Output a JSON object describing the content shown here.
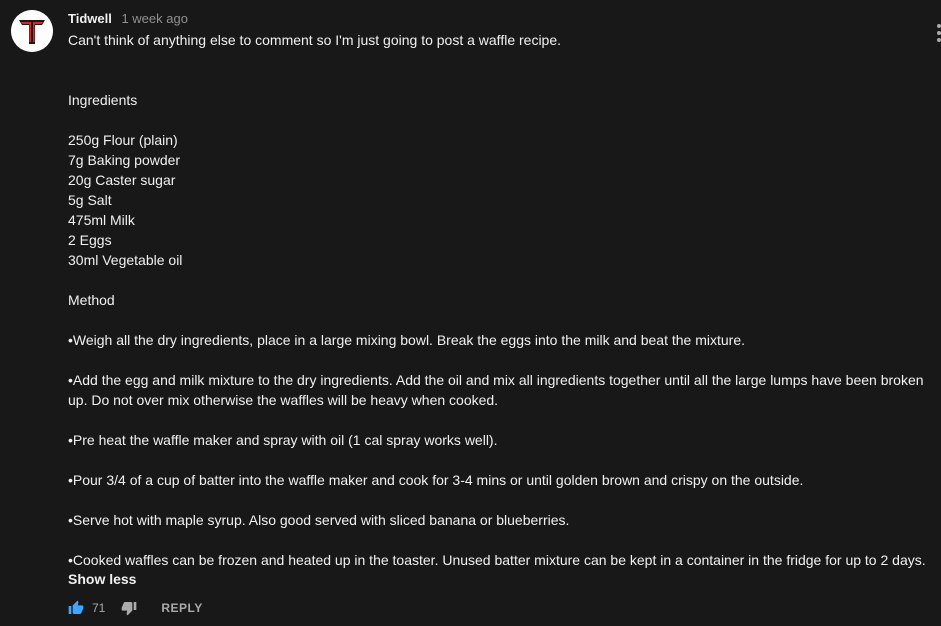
{
  "comment": {
    "author": "Tidwell",
    "timestamp": "1 week ago",
    "lines": [
      "Can't think of anything else to comment so I'm just going to post a waffle recipe.",
      "",
      "",
      "Ingredients",
      "",
      "250g Flour (plain)",
      "7g Baking powder",
      "20g Caster sugar",
      "5g Salt",
      "475ml Milk",
      "2 Eggs",
      "30ml Vegetable oil",
      "",
      "Method",
      "",
      "•Weigh all the dry ingredients, place in a large mixing bowl. Break the eggs into the milk and beat the mixture.",
      "",
      "•Add the egg and milk mixture to the dry ingredients. Add the oil and mix all ingredients together until all the large lumps have been broken up. Do not over mix otherwise the waffles will be heavy when cooked.",
      "",
      "•Pre heat the waffle maker and spray with oil (1 cal spray works well).",
      "",
      "•Pour 3/4 of a cup of batter into the waffle maker and cook for 3-4 mins or until golden brown and crispy on the outside.",
      "",
      "•Serve hot with maple syrup. Also good served with sliced banana or blueberries.",
      "",
      "•Cooked waffles can be frozen and heated up in the toaster. Unused batter mixture can be kept in a container in the fridge for up to 2 days."
    ],
    "show_less_label": "Show less",
    "like_count": "71",
    "reply_label": "REPLY"
  },
  "icons": {
    "avatar": "red-t-logo",
    "like": "thumbs-up-icon",
    "dislike": "thumbs-down-icon",
    "menu": "more-vert-icon"
  },
  "colors": {
    "background": "#181818",
    "text": "#f1f1f1",
    "secondary_text": "#aaaaaa",
    "like_active": "#3ea6ff",
    "avatar_accent": "#e0261f"
  }
}
